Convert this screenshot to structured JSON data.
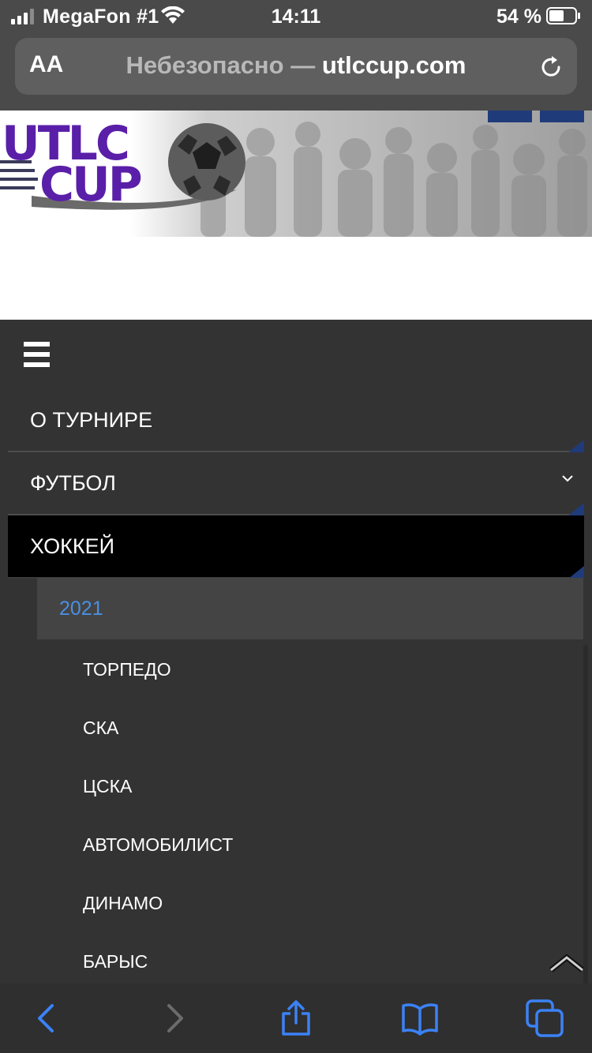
{
  "status_bar": {
    "carrier": "MegaFon #1",
    "time": "14:11",
    "battery": "54 %",
    "icons": [
      "signal-icon",
      "wifi-icon",
      "battery-icon"
    ]
  },
  "url_bar": {
    "text_size_label": "AA",
    "insecure_label": "Небезопасно —",
    "host": "utlccup.com",
    "reload_icon": "reload-icon"
  },
  "banner": {
    "logo_line1": "UTLC",
    "logo_line2": "CUP"
  },
  "menu": {
    "hamburger_icon": "hamburger-icon",
    "items": [
      {
        "label": "О ТУРНИРЕ"
      },
      {
        "label": "ФУТБОЛ",
        "has_dropdown": true
      },
      {
        "label": "ХОККЕЙ",
        "active": true
      }
    ],
    "year": "2021",
    "teams": [
      "ТОРПЕДО",
      "СКА",
      "ЦСКА",
      "АВТОМОБИЛИСТ",
      "ДИНАМО",
      "БАРЫС"
    ]
  },
  "toolbar": {
    "icons": [
      "back-icon",
      "forward-icon",
      "share-icon",
      "bookmarks-icon",
      "tabs-icon"
    ]
  },
  "colors": {
    "menu_bg": "#333333",
    "active_bg": "#000000",
    "year_bg": "#444444",
    "link_blue": "#4a90e2",
    "logo_purple": "#5a1fa8",
    "safari_blue": "#3b82f6"
  }
}
